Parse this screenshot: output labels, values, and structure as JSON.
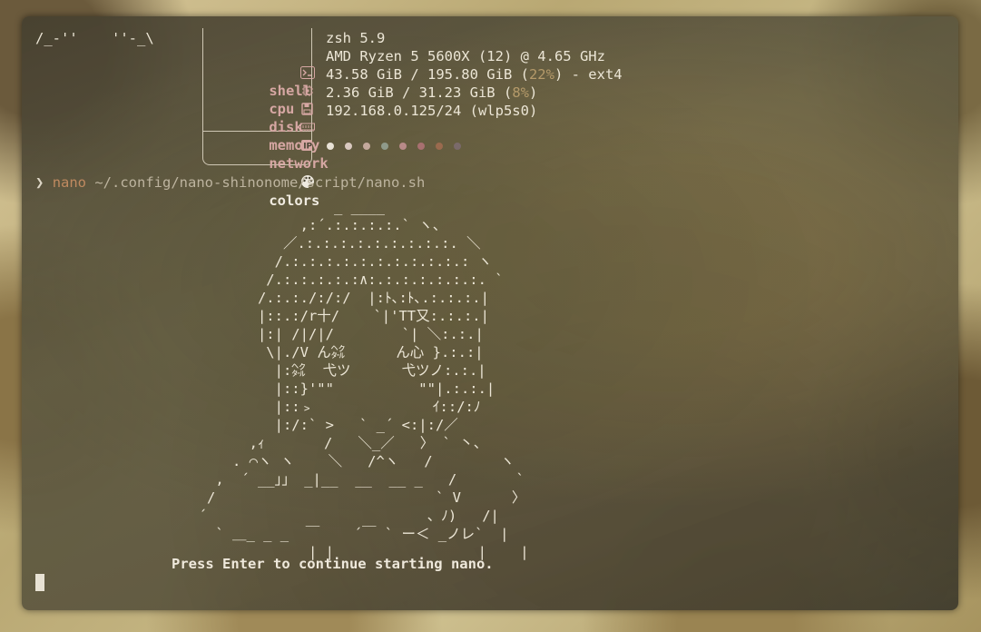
{
  "terminal": {
    "logo": "/_-''    ''-_\\",
    "info": [
      {
        "key": "shell",
        "icon": "terminal-icon",
        "value": "zsh 5.9"
      },
      {
        "key": "cpu",
        "icon": "cpu-icon",
        "value": "AMD Ryzen 5 5600X (12) @ 4.65 GHz"
      },
      {
        "key": "disk",
        "icon": "disk-icon",
        "value_pre": "43.58 GiB / 195.80 GiB (",
        "value_pct": "22%",
        "value_post": ") - ext4"
      },
      {
        "key": "memory",
        "icon": "memory-icon",
        "value_pre": "2.36 GiB / 31.23 GiB (",
        "value_pct": "8%",
        "value_post": ")"
      },
      {
        "key": "network",
        "icon": "network-icon",
        "value": "192.168.0.125/24 (wlp5s0)"
      }
    ],
    "colors_label": "colors",
    "palette": [
      "#e8e2d6",
      "#d9c9c0",
      "#c4a99c",
      "#8f9a8a",
      "#b88a88",
      "#a87070",
      "#9a6a4e",
      "#7a6a6a"
    ],
    "prompt": {
      "arrow": "❯",
      "command": "nano",
      "args": " ~/.config/nano-shinonome/script/nano.sh"
    },
    "ascii_art": "                        _ ____\n                    ,:´.:.:.:.:.` ヽ、\n                  ／.:.:.:.:.:.:.:.:.:. ＼\n                 /.:.:.:.:.:.:.:.:.:.:.: ヽ\n                /.:.:.:.:.:∧:.:.:.:.:.:.:. `\n               /.:.:./:/:/  |:ﾄ､:ﾄ､.:.:.:.|\n               |::.:/r十/    `|'TT又:.:.:.|\n               |:| /|/|/        `| ＼:.:.|\n                \\|./V ん㌶      ん心 }.:.:|\n                 |:㌶  弋ツ      弋ツノ:.:.|\n                 |::}'\"\"          \"\"|.:.:.|\n                 |::﹥              ｲ::/:ﾉ\n                 |:/:` >   ` _´ <:|:/／\n              ,ｨ       /   ＼_／   〉 ` 丶、\n            . ⌒ヽ ヽ    ＼   /^ヽ   /        ヽ\n          ,  ´ __」」 _|__  __  __ _   /       `\n         /                          ` V      〉\n        ´                          、ﾉ)   /|\n          ` ＿_ _ _  ￣    ´￣ ` ー＜ _ノレ`  |\n                     | |                 |    |",
    "press_text": "Press Enter to continue starting nano."
  }
}
